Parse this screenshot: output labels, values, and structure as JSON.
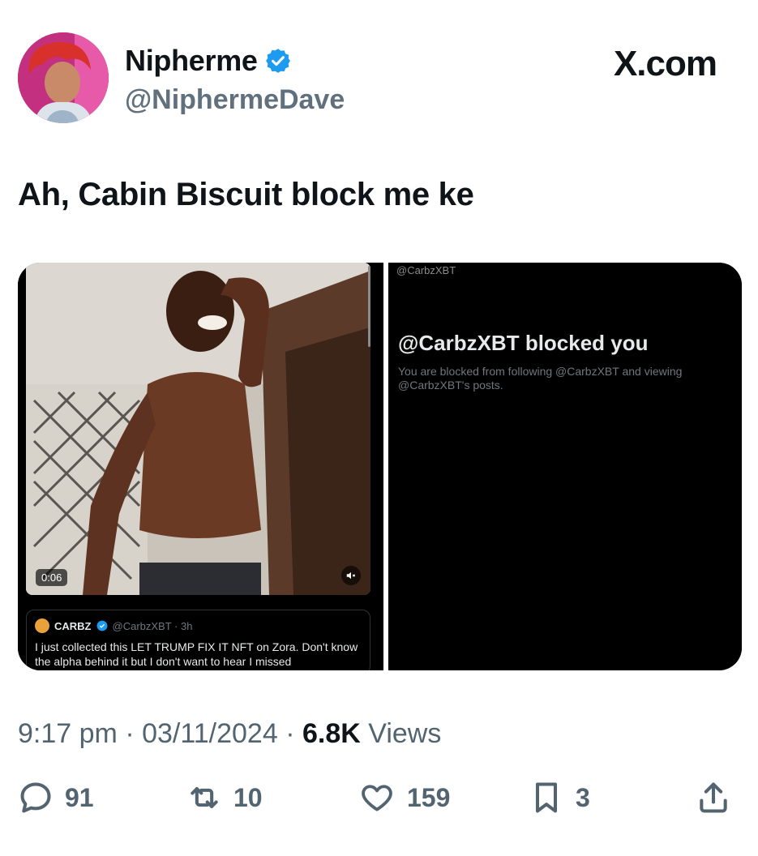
{
  "author": {
    "display_name": "Nipherme",
    "handle": "@NiphermeDave",
    "verified": true
  },
  "brand": "X.com",
  "tweet": {
    "text": "Ah, Cabin Biscuit block me ke"
  },
  "media": {
    "video": {
      "timestamp": "0:06"
    },
    "quoted_post": {
      "name": "CARBZ",
      "handle_time": "@CarbzXBT · 3h",
      "text": "I just collected this LET TRUMP FIX IT NFT on Zora. Don't know the alpha behind it but I don't want to hear I missed"
    },
    "blocked_screen": {
      "top_handle": "@CarbzXBT",
      "title": "@CarbzXBT blocked you",
      "subtitle": "You are blocked from following @CarbzXBT and viewing @CarbzXBT's posts."
    }
  },
  "meta": {
    "time": "9:17 pm",
    "date": "03/11/2024",
    "views_count": "6.8K",
    "views_label": "Views"
  },
  "actions": {
    "replies": "91",
    "reposts": "10",
    "likes": "159",
    "bookmarks": "3"
  },
  "colors": {
    "verified_blue": "#1d9bf0",
    "secondary_text": "#536471"
  }
}
